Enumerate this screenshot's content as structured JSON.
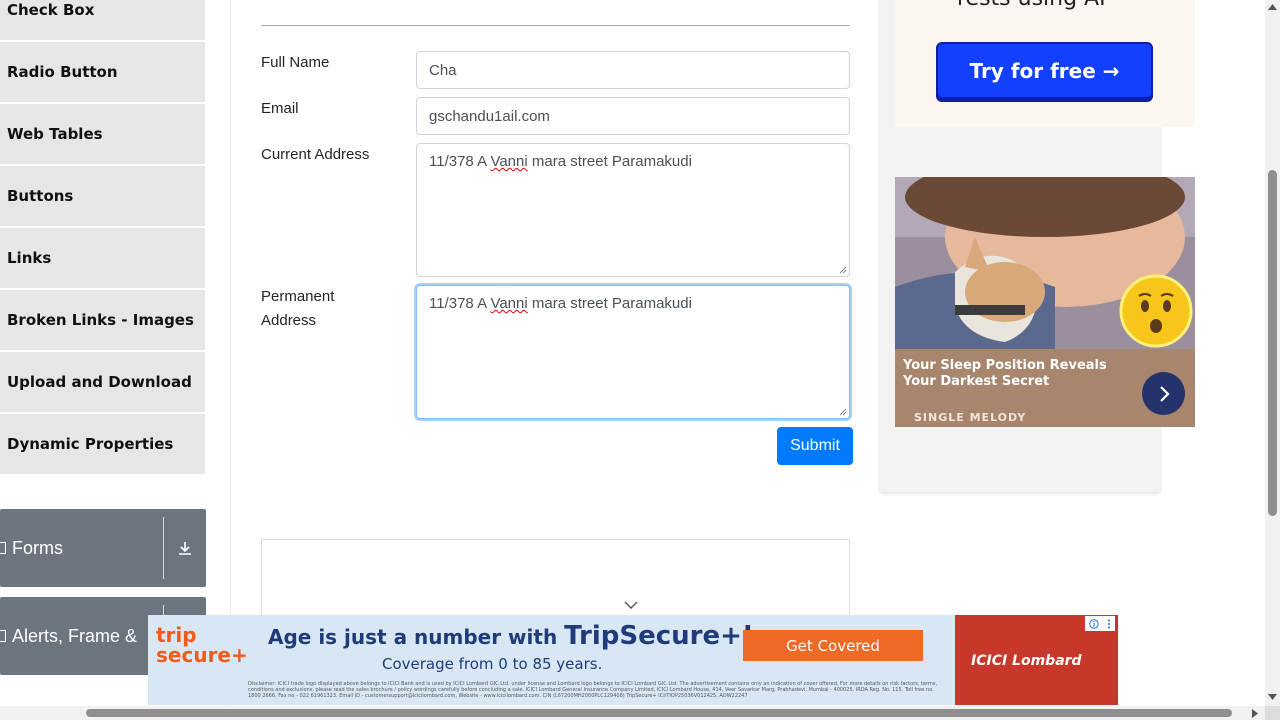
{
  "sidebar": {
    "items": [
      {
        "label": "Check Box"
      },
      {
        "label": "Radio Button"
      },
      {
        "label": "Web Tables"
      },
      {
        "label": "Buttons"
      },
      {
        "label": "Links"
      },
      {
        "label": "Broken Links - Images"
      },
      {
        "label": "Upload and Download"
      },
      {
        "label": "Dynamic Properties"
      }
    ],
    "groups": [
      {
        "label": "Forms"
      },
      {
        "label": "Alerts, Frame & "
      }
    ]
  },
  "form": {
    "full_name_label": "Full Name",
    "full_name_value": "Cha",
    "email_label": "Email",
    "email_value": "gschandu1ail.com",
    "current_address_label": "Current Address",
    "current_address_value_pre": "11/378 A ",
    "current_address_value_squig": "Vanni",
    "current_address_value_post": " mara street Paramakudi",
    "permanent_address_label": "Permanent Address",
    "permanent_address_value_pre": "11/378 A ",
    "permanent_address_value_squig": "Vanni",
    "permanent_address_value_post": " mara street Paramakudi",
    "submit_label": "Submit"
  },
  "ads": {
    "top_headline": "rests using AI",
    "try_button": "Try for free →",
    "sleep_text": "Your Sleep Position Reveals Your Darkest Secret",
    "sleep_brand": "SINGLE MELODY"
  },
  "banner": {
    "logo_top": "trip",
    "logo_bottom": "secure+",
    "headline_pre": "Age is just a number with ",
    "headline_brand": "TripSecure+!",
    "subline": "Coverage from 0 to 85 years.",
    "cta": "Get Covered",
    "icici": "ICICI Lombard",
    "disclaimer": "Disclaimer: ICICI trade logo displayed above belongs to ICICI Bank and is used by ICICI Lombard GIC Ltd. under license and Lombard logo belongs to ICICI Lombard GIC Ltd. The advertisement contains only an indication of cover offered. For more details on risk factors, terms, conditions and exclusions, please read the sales brochure / policy wordings carefully before concluding a sale. ICICI Lombard General Insurance Company Limited, ICICI Lombard House, 414, Veer Savarkar Marg, Prabhadevi, Mumbai - 400025. IRDA Reg. No. 115. Toll free no. 1800 2666, Fax no - 022 61961323. Email ID - customersupport@icicilombard.com, Website - www.icicilombard.com. CIN (L67200MH2000PLC129408) TripSecure+ ICI/TIOP25036V012425, ADW22247"
  },
  "colors": {
    "primary": "#007bff",
    "sidebar_bg": "#e6e6e6",
    "group_bg": "#6c757d"
  }
}
